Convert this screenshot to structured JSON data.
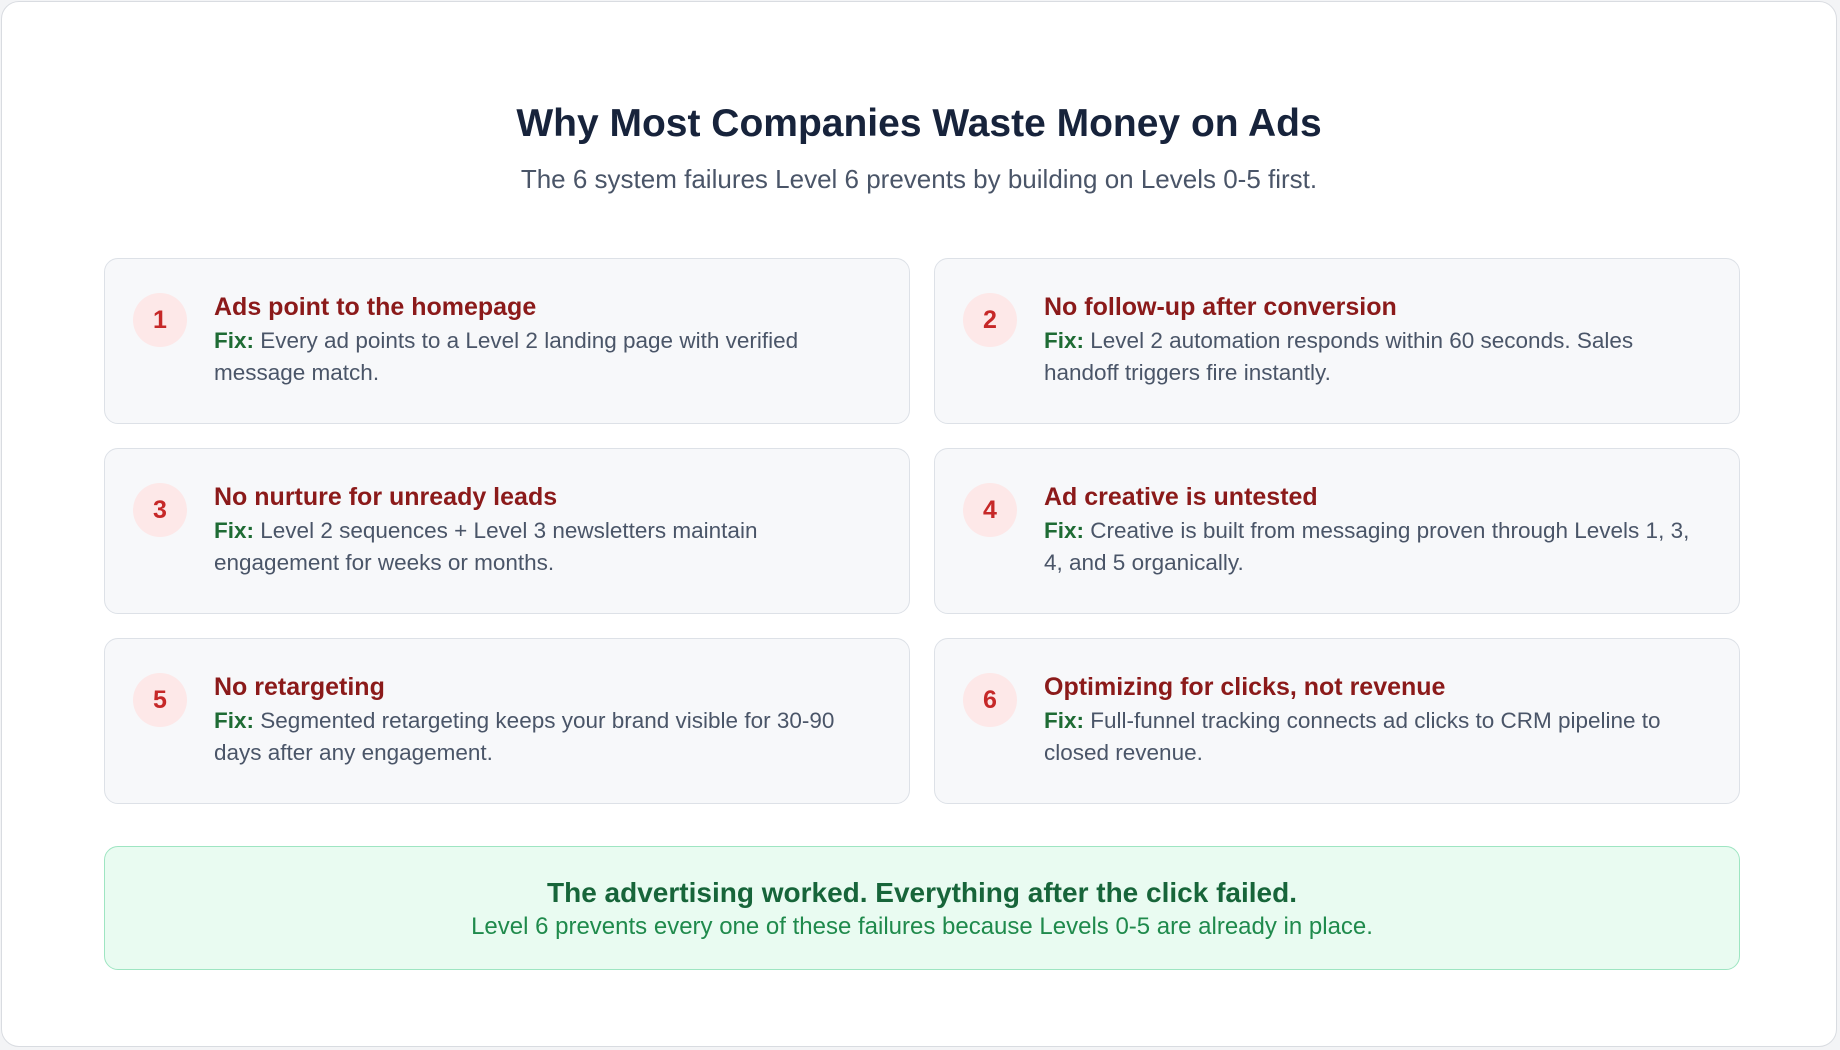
{
  "header": {
    "title": "Why Most Companies Waste Money on Ads",
    "subtitle": "The 6 system failures Level 6 prevents by building on Levels 0-5 first."
  },
  "failures": [
    {
      "number": "1",
      "title": "Ads point to the homepage",
      "fix_label": "Fix:",
      "fix_text": "Every ad points to a Level 2 landing page with verified message match."
    },
    {
      "number": "2",
      "title": "No follow-up after conversion",
      "fix_label": "Fix:",
      "fix_text": "Level 2 automation responds within 60 seconds. Sales handoff triggers fire instantly."
    },
    {
      "number": "3",
      "title": "No nurture for unready leads",
      "fix_label": "Fix:",
      "fix_text": "Level 2 sequences + Level 3 newsletters maintain engagement for weeks or months."
    },
    {
      "number": "4",
      "title": "Ad creative is untested",
      "fix_label": "Fix:",
      "fix_text": "Creative is built from messaging proven through Levels 1, 3, 4, and 5 organically."
    },
    {
      "number": "5",
      "title": "No retargeting",
      "fix_label": "Fix:",
      "fix_text": "Segmented retargeting keeps your brand visible for 30-90 days after any engagement."
    },
    {
      "number": "6",
      "title": "Optimizing for clicks, not revenue",
      "fix_label": "Fix:",
      "fix_text": "Full-funnel tracking connects ad clicks to CRM pipeline to closed revenue."
    }
  ],
  "summary": {
    "title": "The advertising worked. Everything after the click failed.",
    "text": "Level 6 prevents every one of these failures because Levels 0-5 are already in place."
  },
  "colors": {
    "title": "#17233b",
    "failure_title": "#8b1a1a",
    "number": "#c62828",
    "number_bg": "#fde8e8",
    "fix_label": "#1e6b34",
    "summary_bg": "#e9fbf1",
    "summary_border": "#9ee5c2",
    "summary_title": "#17653a",
    "summary_text": "#1f8a4c"
  }
}
